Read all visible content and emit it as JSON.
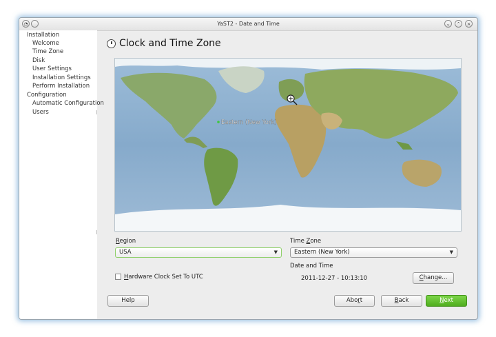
{
  "window": {
    "title": "YaST2 - Date and Time"
  },
  "sidebar": {
    "sections": [
      {
        "label": "Installation",
        "items": [
          "Welcome",
          "Time Zone",
          "Disk",
          "User Settings",
          "Installation Settings",
          "Perform Installation"
        ]
      },
      {
        "label": "Configuration",
        "items": [
          "Automatic Configuration",
          "Users"
        ]
      }
    ]
  },
  "page": {
    "title": "Clock and Time Zone"
  },
  "map": {
    "marker_label": "Eastern (New York)"
  },
  "region": {
    "label": "Region",
    "mnemonic": "R",
    "value": "USA"
  },
  "timezone": {
    "label": "Time Zone",
    "mnemonic": "Z",
    "value": "Eastern (New York)"
  },
  "hwclock": {
    "label": "Hardware Clock Set To UTC",
    "mnemonic": "H",
    "checked": false
  },
  "datetime": {
    "label": "Date and Time",
    "value": "2011-12-27 - 10:13:10",
    "change_label": "Change...",
    "change_mnemonic": "C"
  },
  "buttons": {
    "help": "Help",
    "abort": "Abort",
    "abort_mnemonic": "r",
    "back": "Back",
    "back_mnemonic": "B",
    "next": "Next",
    "next_mnemonic": "N"
  },
  "colors": {
    "accent_green": "#5cbf2a",
    "focus_border": "#8fd06a",
    "ocean": "#8fb3d4",
    "land": "#8aa86a"
  }
}
